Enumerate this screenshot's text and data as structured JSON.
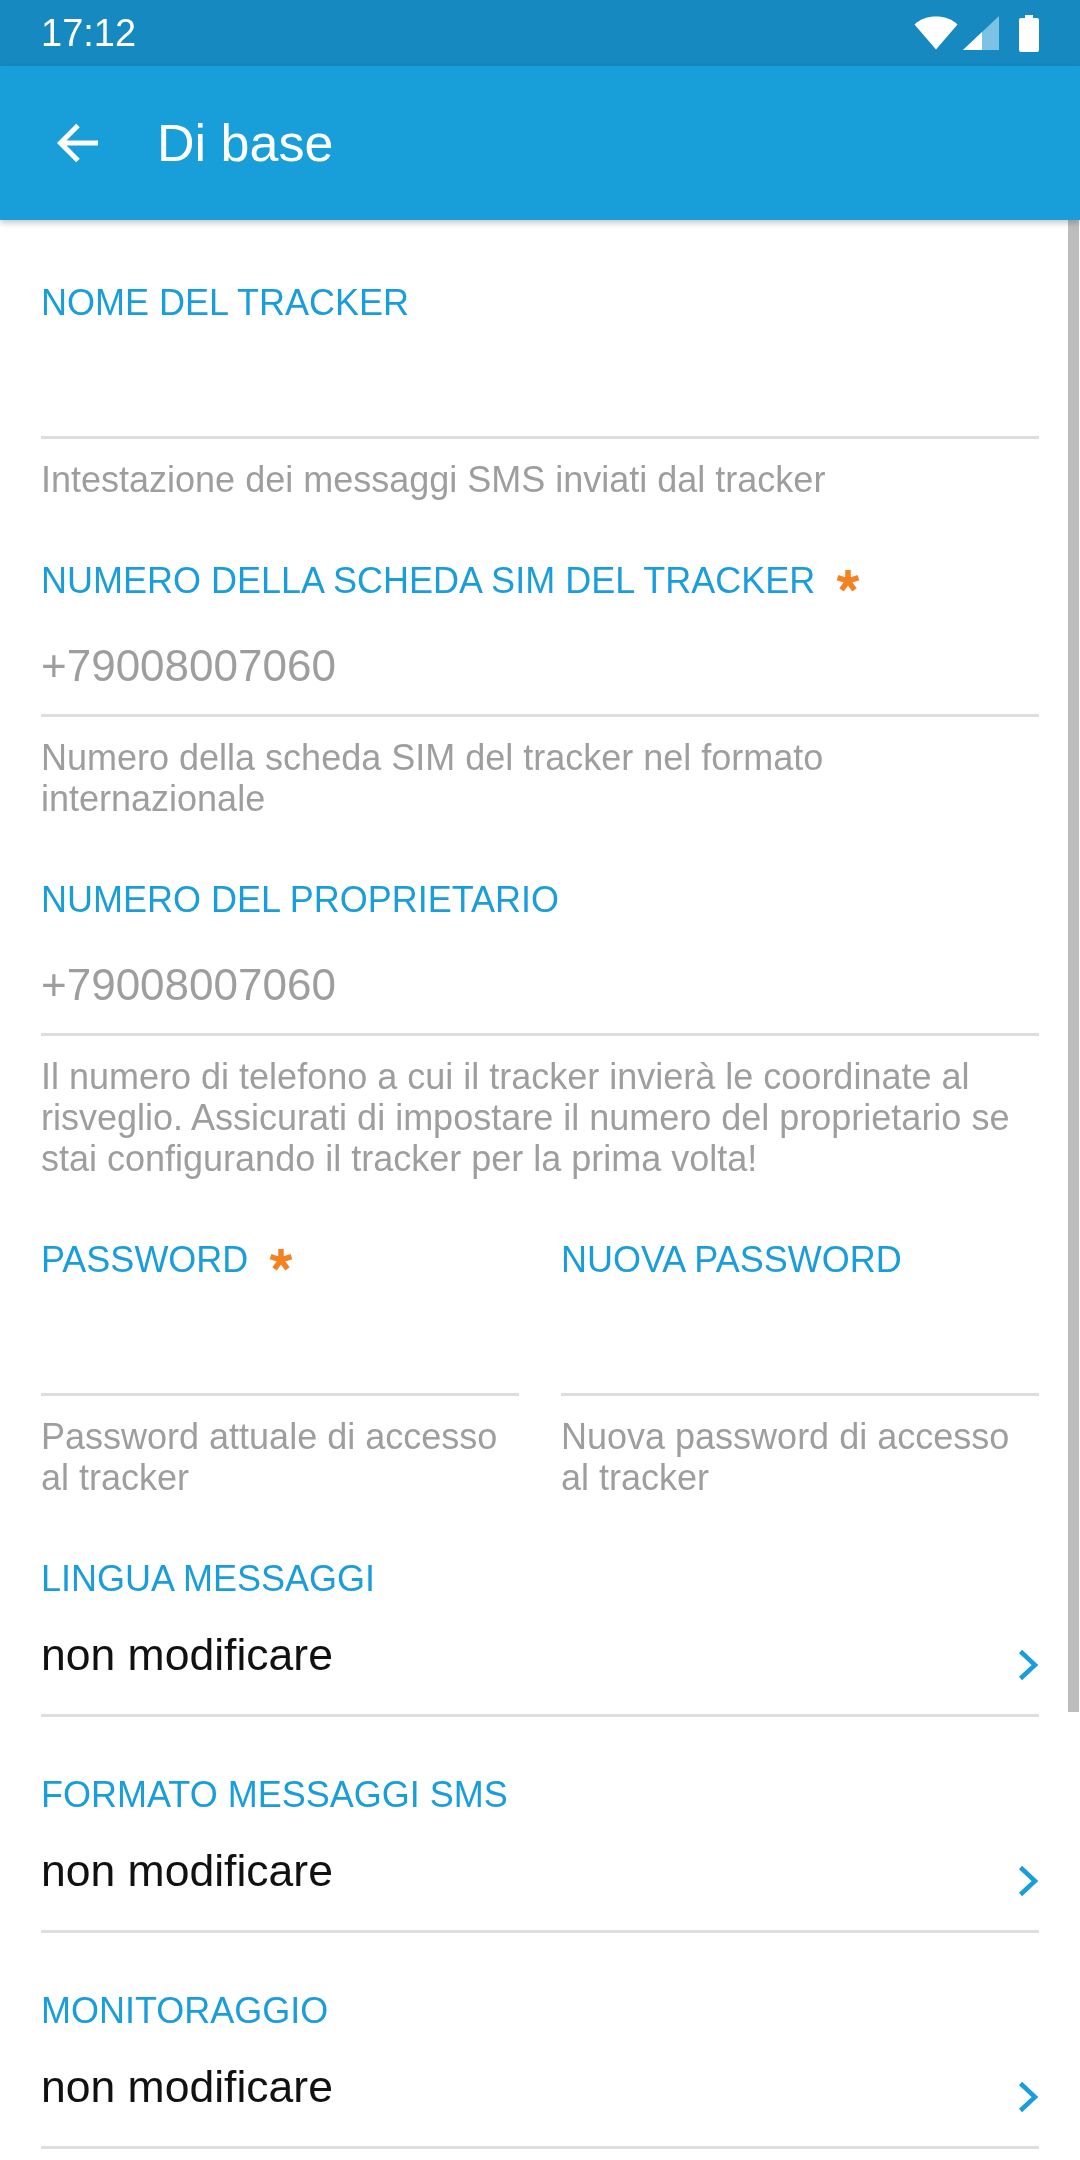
{
  "status_bar": {
    "time": "17:12"
  },
  "app_bar": {
    "title": "Di base"
  },
  "fields": [
    {
      "label": "NOME DEL TRACKER",
      "required": false,
      "helper": "Intestazione dei messaggi SMS inviati dal tracker"
    },
    {
      "label": "NUMERO DELLA SCHEDA SIM DEL TRACKER",
      "required": true,
      "placeholder": "+79008007060",
      "helper": "Numero della scheda SIM del tracker nel formato internazionale"
    },
    {
      "label": "NUMERO DEL PROPRIETARIO",
      "required": false,
      "placeholder": "+79008007060",
      "helper": "Il numero di telefono a cui il tracker invierà le coordinate al risveglio. Assicurati di impostare il numero del proprietario se stai configurando il tracker per la prima volta!"
    }
  ],
  "password_fields": [
    {
      "label": "PASSWORD",
      "required": true,
      "helper": "Password attuale di accesso al tracker"
    },
    {
      "label": "NUOVA PASSWORD",
      "required": false,
      "helper": "Nuova password di accesso al tracker"
    }
  ],
  "selects": [
    {
      "label": "LINGUA MESSAGGI",
      "value": "non modificare"
    },
    {
      "label": "FORMATO MESSAGGI SMS",
      "value": "non modificare"
    },
    {
      "label": "MONITORAGGIO",
      "value": "non modificare"
    }
  ]
}
